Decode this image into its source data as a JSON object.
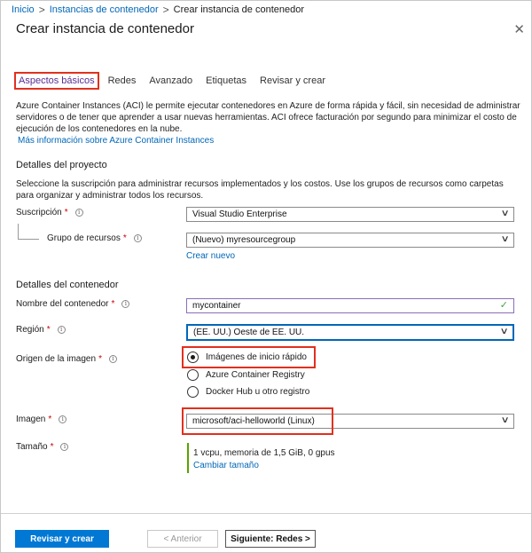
{
  "breadcrumb": {
    "home": "Inicio",
    "parent": "Instancias de contenedor",
    "current": "Crear instancia de contenedor",
    "separator": ">"
  },
  "page": {
    "title": "Crear instancia de contenedor",
    "close_glyph": "✕"
  },
  "tabs": [
    {
      "label": "Aspectos básicos",
      "active": true
    },
    {
      "label": "Redes"
    },
    {
      "label": "Avanzado"
    },
    {
      "label": "Etiquetas"
    },
    {
      "label": "Revisar y crear"
    }
  ],
  "intro": {
    "text": "Azure Container Instances (ACI) le permite ejecutar contenedores en Azure de forma rápida y fácil, sin necesidad de administrar servidores o de tener que aprender a usar nuevas herramientas. ACI ofrece facturación por segundo para minimizar el costo de ejecución de los contenedores en la nube.",
    "link": "Más información sobre Azure Container Instances"
  },
  "project": {
    "heading": "Detalles del proyecto",
    "description": "Seleccione la suscripción para administrar recursos implementados y los costos. Use los grupos de recursos como carpetas para organizar y administrar todos los recursos.",
    "subscription_label": "Suscripción",
    "subscription_value": "Visual Studio Enterprise",
    "resource_group_label": "Grupo de recursos",
    "resource_group_value": "(Nuevo) myresourcegroup",
    "create_new": "Crear nuevo"
  },
  "container": {
    "heading": "Detalles del contenedor",
    "name_label": "Nombre del contenedor",
    "name_value": "mycontainer",
    "region_label": "Región",
    "region_value": "(EE. UU.) Oeste de EE. UU.",
    "image_source_label": "Origen de la imagen",
    "image_source_options": [
      {
        "label": "Imágenes de inicio rápido",
        "selected": true
      },
      {
        "label": "Azure Container Registry",
        "selected": false
      },
      {
        "label": "Docker Hub u otro registro",
        "selected": false
      }
    ],
    "image_label": "Imagen",
    "image_value": "microsoft/aci-helloworld (Linux)",
    "size_label": "Tamaño",
    "size_value": "1 vcpu, memoria de 1,5 GiB, 0 gpus",
    "change_size": "Cambiar tamaño"
  },
  "common": {
    "required_mark": "*",
    "info_glyph": "i",
    "chevron_glyph": "∨",
    "check_glyph": "✓"
  },
  "footer": {
    "review_create": "Revisar y crear",
    "previous": "< Anterior",
    "next": "Siguiente: Redes >"
  },
  "colors": {
    "accent": "#0078d4",
    "link": "#0067b8",
    "highlight_box": "#e1301e",
    "active_tab": "#5c2d91",
    "valid_check": "#46a046"
  }
}
